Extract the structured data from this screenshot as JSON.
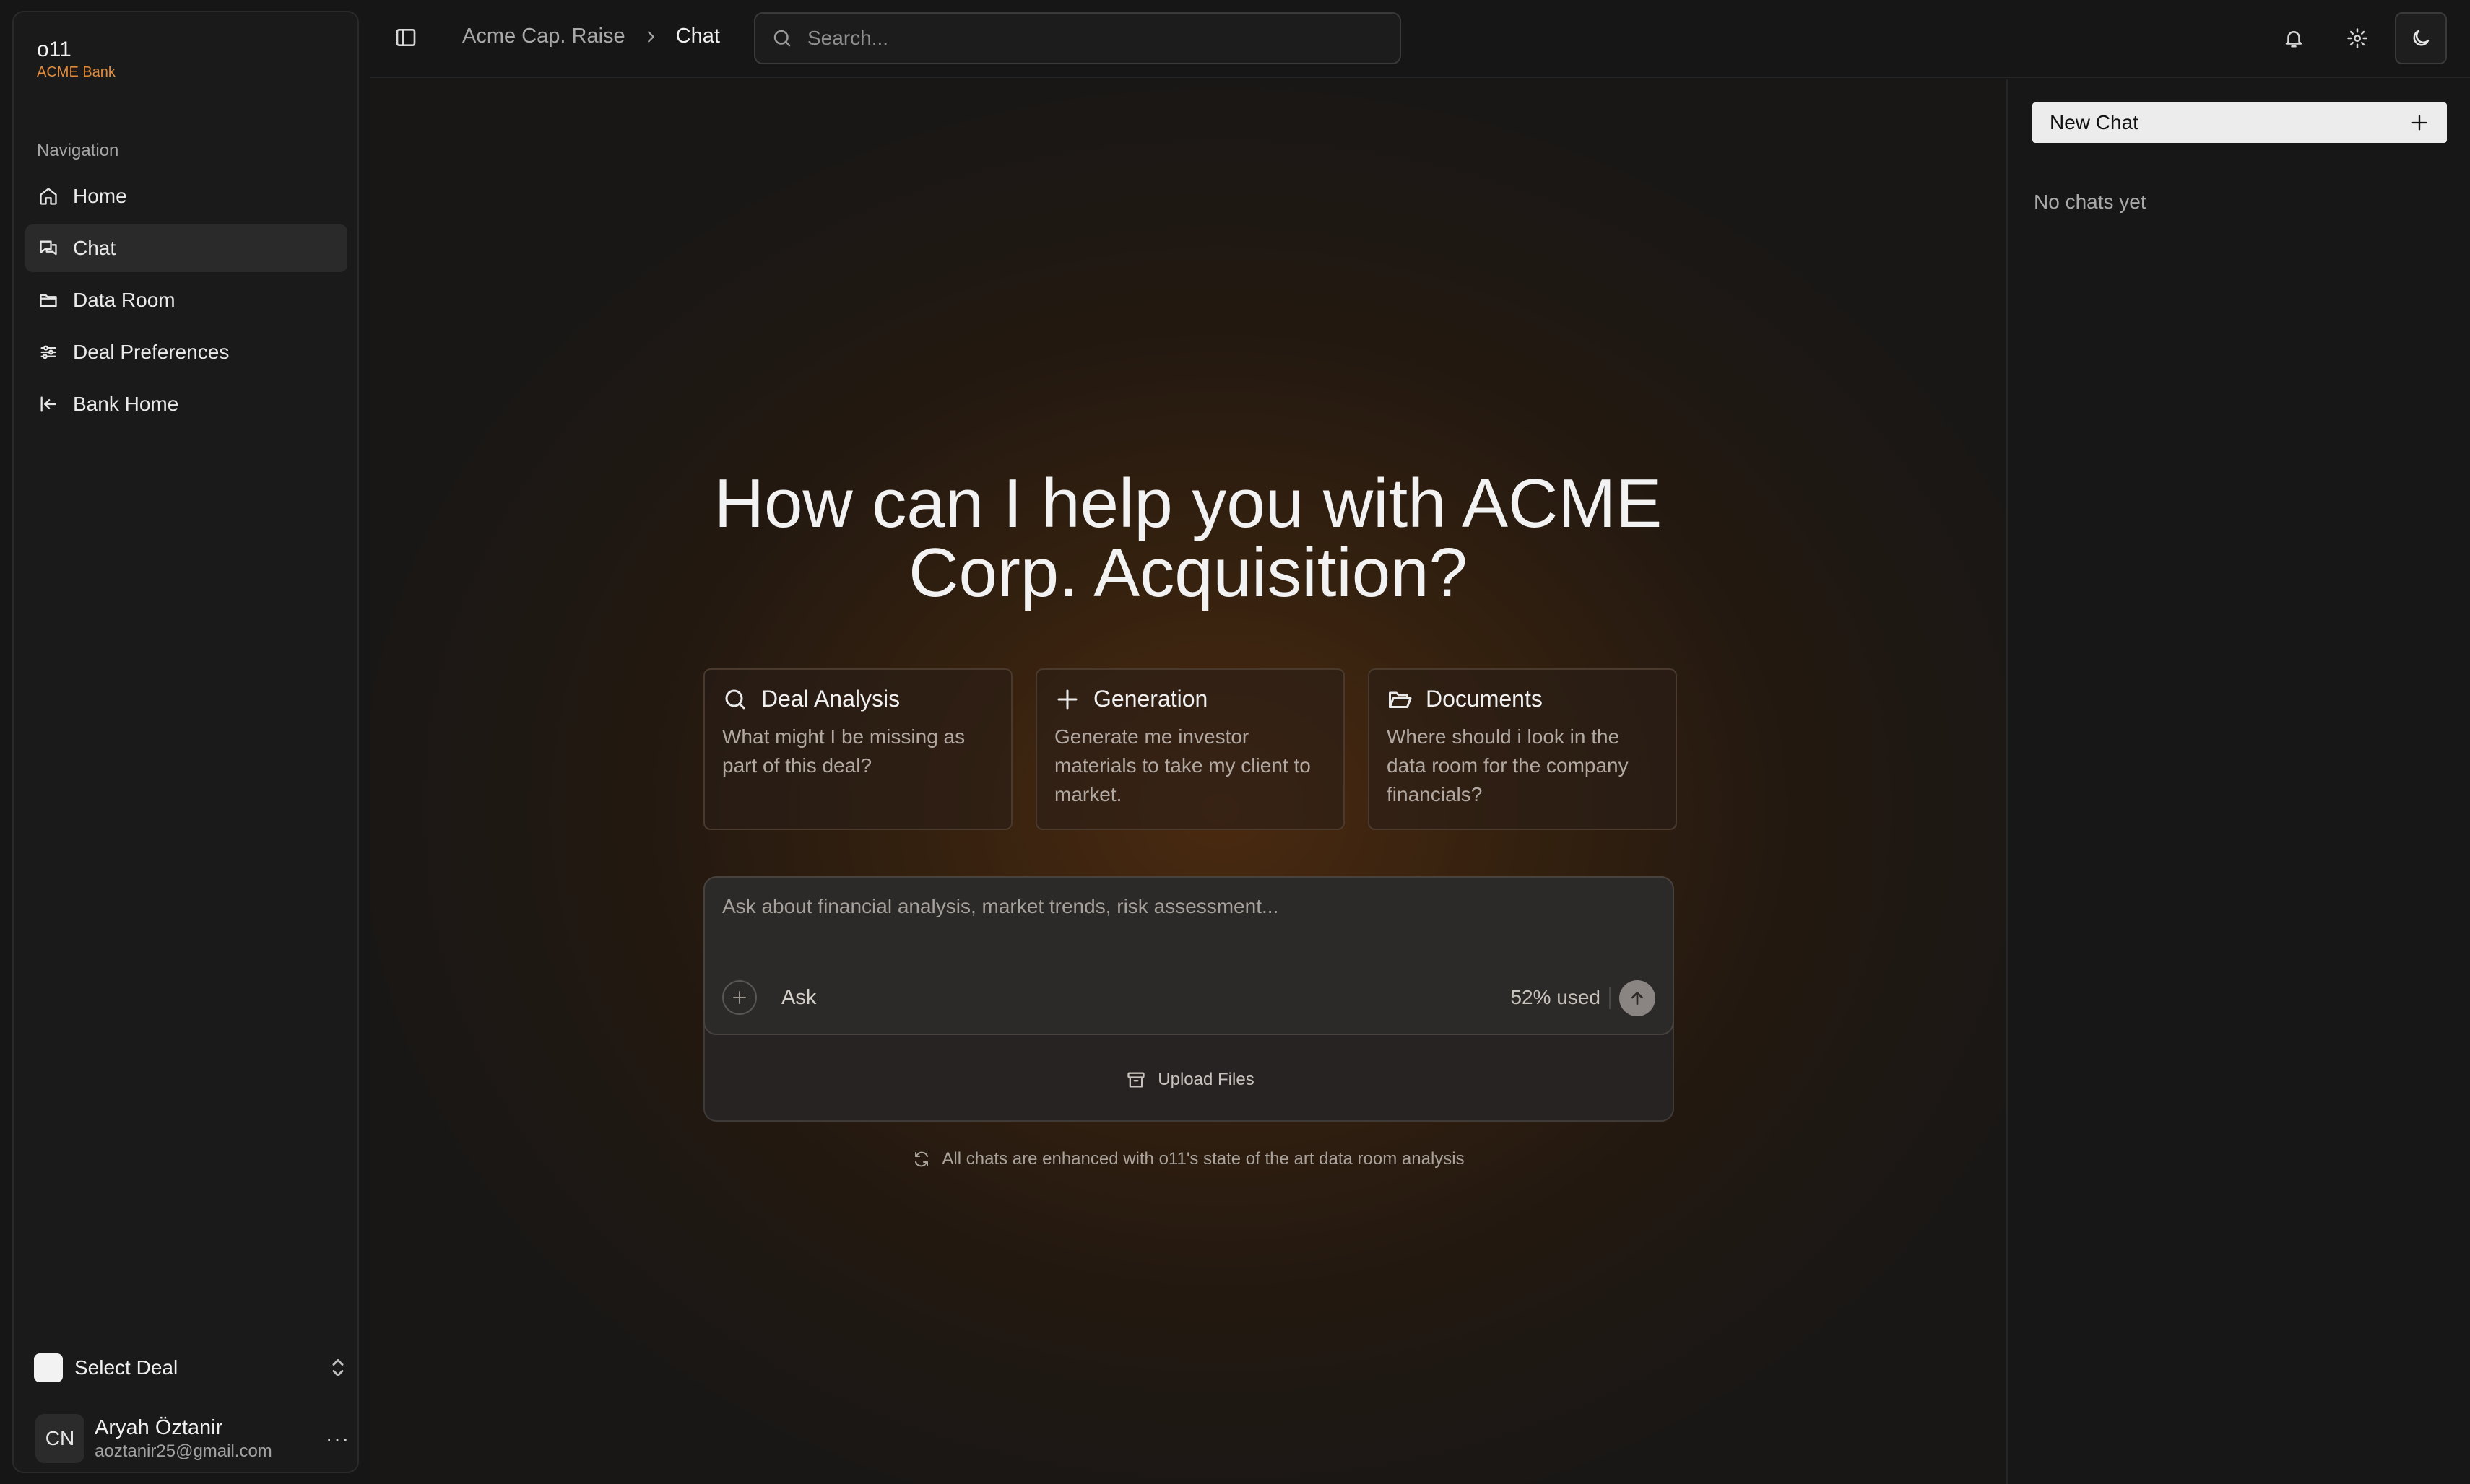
{
  "brand": {
    "name": "o11",
    "sub": "ACME Bank"
  },
  "nav": {
    "heading": "Navigation",
    "items": [
      {
        "label": "Home",
        "icon": "home-icon",
        "active": false
      },
      {
        "label": "Chat",
        "icon": "chat-icon",
        "active": true
      },
      {
        "label": "Data Room",
        "icon": "folder-icon",
        "active": false
      },
      {
        "label": "Deal Preferences",
        "icon": "sliders-icon",
        "active": false
      },
      {
        "label": "Bank Home",
        "icon": "arrow-left-to-line-icon",
        "active": false
      }
    ]
  },
  "deal_selector": {
    "label": "Select Deal"
  },
  "user": {
    "initials": "CN",
    "name": "Aryah Öztanir",
    "email": "aoztanir25@gmail.com",
    "more": "···"
  },
  "header": {
    "breadcrumb": [
      "Acme Cap. Raise",
      "Chat"
    ],
    "search_placeholder": "Search..."
  },
  "main": {
    "title": "How can I help you with ACME Corp. Acquisition?",
    "cards": [
      {
        "title": "Deal Analysis",
        "icon": "search-icon",
        "desc": "What might I be missing as part of this deal?"
      },
      {
        "title": "Generation",
        "icon": "plus-icon",
        "desc": "Generate me investor materials to take my client to market."
      },
      {
        "title": "Documents",
        "icon": "folder-open-icon",
        "desc": "Where should i look in the data room for the company financials?"
      }
    ],
    "composer": {
      "placeholder": "Ask about financial analysis, market trends, risk assessment...",
      "mode": "Ask",
      "usage": "52% used",
      "upload": "Upload Files"
    },
    "footnote": "All chats are enhanced with o11's state of the art data room analysis"
  },
  "chats_panel": {
    "new_chat": "New Chat",
    "empty": "No chats yet"
  },
  "colors": {
    "accent": "#e08a3c",
    "background": "#161616",
    "glow": "#4a2a10"
  }
}
